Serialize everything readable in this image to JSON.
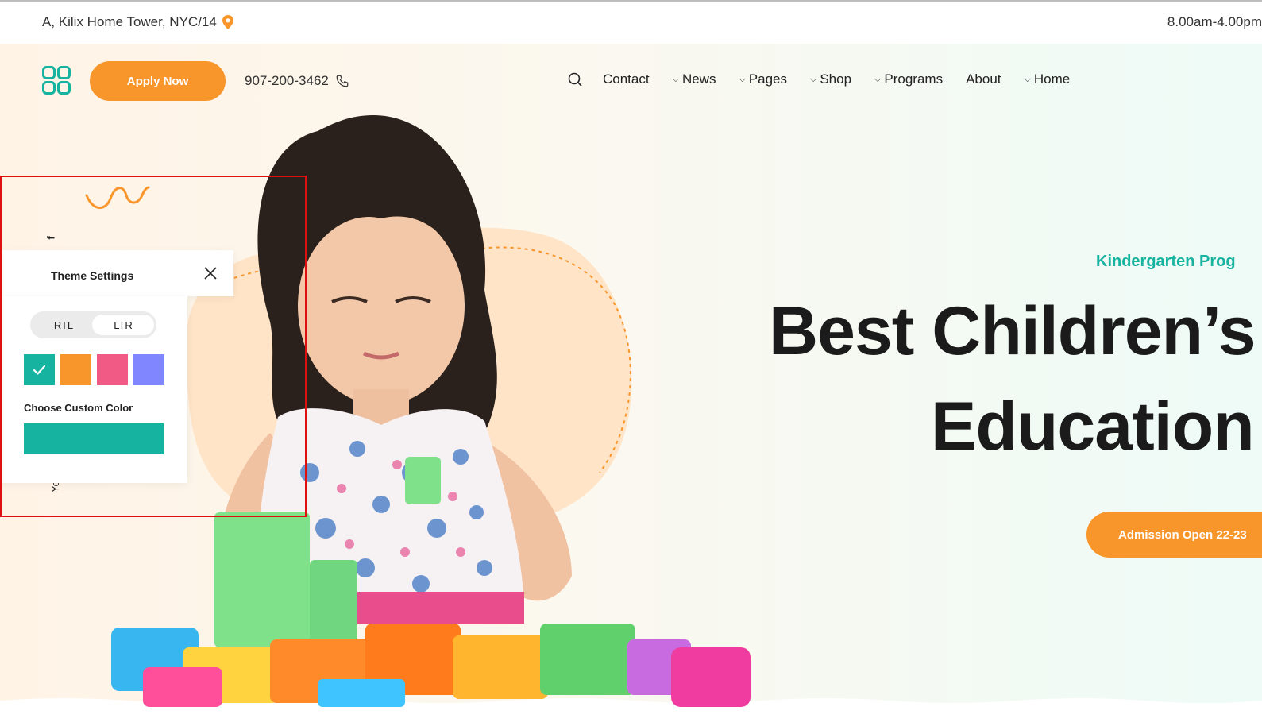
{
  "topbar": {
    "address": "A, Kilix Home Tower, NYC/14",
    "address_icon": "map-pin-icon",
    "hours": "8.00am-4.00pm"
  },
  "header": {
    "logo_icon": "grid-logo-icon",
    "apply_label": "Apply Now",
    "phone": "907-200-3462",
    "phone_icon": "phone-icon",
    "search_icon": "search-icon",
    "nav": [
      {
        "label": "Contact",
        "dropdown": false
      },
      {
        "label": "News",
        "dropdown": true
      },
      {
        "label": "Pages",
        "dropdown": true
      },
      {
        "label": "Shop",
        "dropdown": true
      },
      {
        "label": "Programs",
        "dropdown": true
      },
      {
        "label": "About",
        "dropdown": false
      },
      {
        "label": "Home",
        "dropdown": true
      }
    ]
  },
  "hero": {
    "kicker": "Kindergarten Prog",
    "heading_line1": "Best Children’s",
    "heading_line2": "Education",
    "cta_label": "Admission Open 22-23",
    "side_text_top": "f",
    "side_text_bottom": "Yo"
  },
  "theme_settings": {
    "title": "Theme Settings",
    "close_icon": "close-icon",
    "dir_options": [
      "RTL",
      "LTR"
    ],
    "dir_selected": "LTR",
    "swatches": [
      "#15b3a0",
      "#f9962b",
      "#f25a86",
      "#7f86ff"
    ],
    "selected_swatch": "#15b3a0",
    "check_icon": "check-icon",
    "custom_color_label": "Choose Custom Color",
    "custom_color_value": "#15b3a0"
  },
  "colors": {
    "accent_orange": "#f9962b",
    "accent_teal": "#15b3a0",
    "highlight_box": "#e01010"
  }
}
